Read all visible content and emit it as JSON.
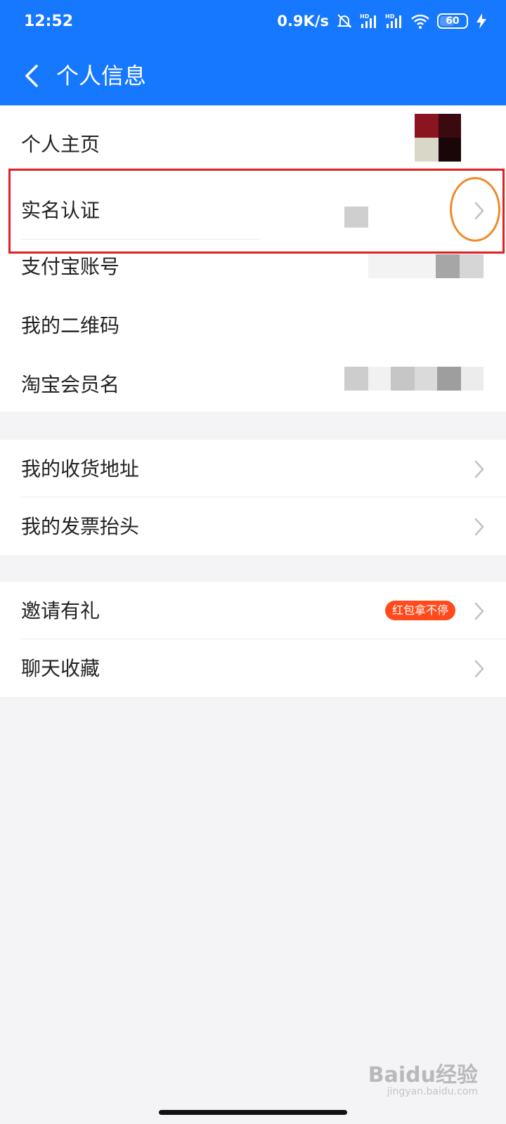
{
  "status_bar": {
    "time": "12:52",
    "net_speed": "0.9K/s",
    "signal_label": "HD",
    "battery": "60",
    "battery_level": 0.6
  },
  "header": {
    "title": "个人信息",
    "color": "#1677ff"
  },
  "section1": {
    "items": [
      {
        "label": "个人主页"
      },
      {
        "label": "实名认证"
      },
      {
        "label": "支付宝账号"
      },
      {
        "label": "我的二维码"
      },
      {
        "label": "淘宝会员名"
      }
    ]
  },
  "section2": {
    "items": [
      {
        "label": "我的收货地址"
      },
      {
        "label": "我的发票抬头"
      }
    ]
  },
  "section3": {
    "items": [
      {
        "label": "邀请有礼",
        "badge": "红包拿不停"
      },
      {
        "label": "聊天收藏"
      }
    ]
  },
  "watermark": {
    "brand": "Baidu经验",
    "url": "jingyan.baidu.com"
  },
  "colors": {
    "highlight_box": "#e02020",
    "highlight_ring": "#f08a2a",
    "badge": "#ff4a1c"
  }
}
